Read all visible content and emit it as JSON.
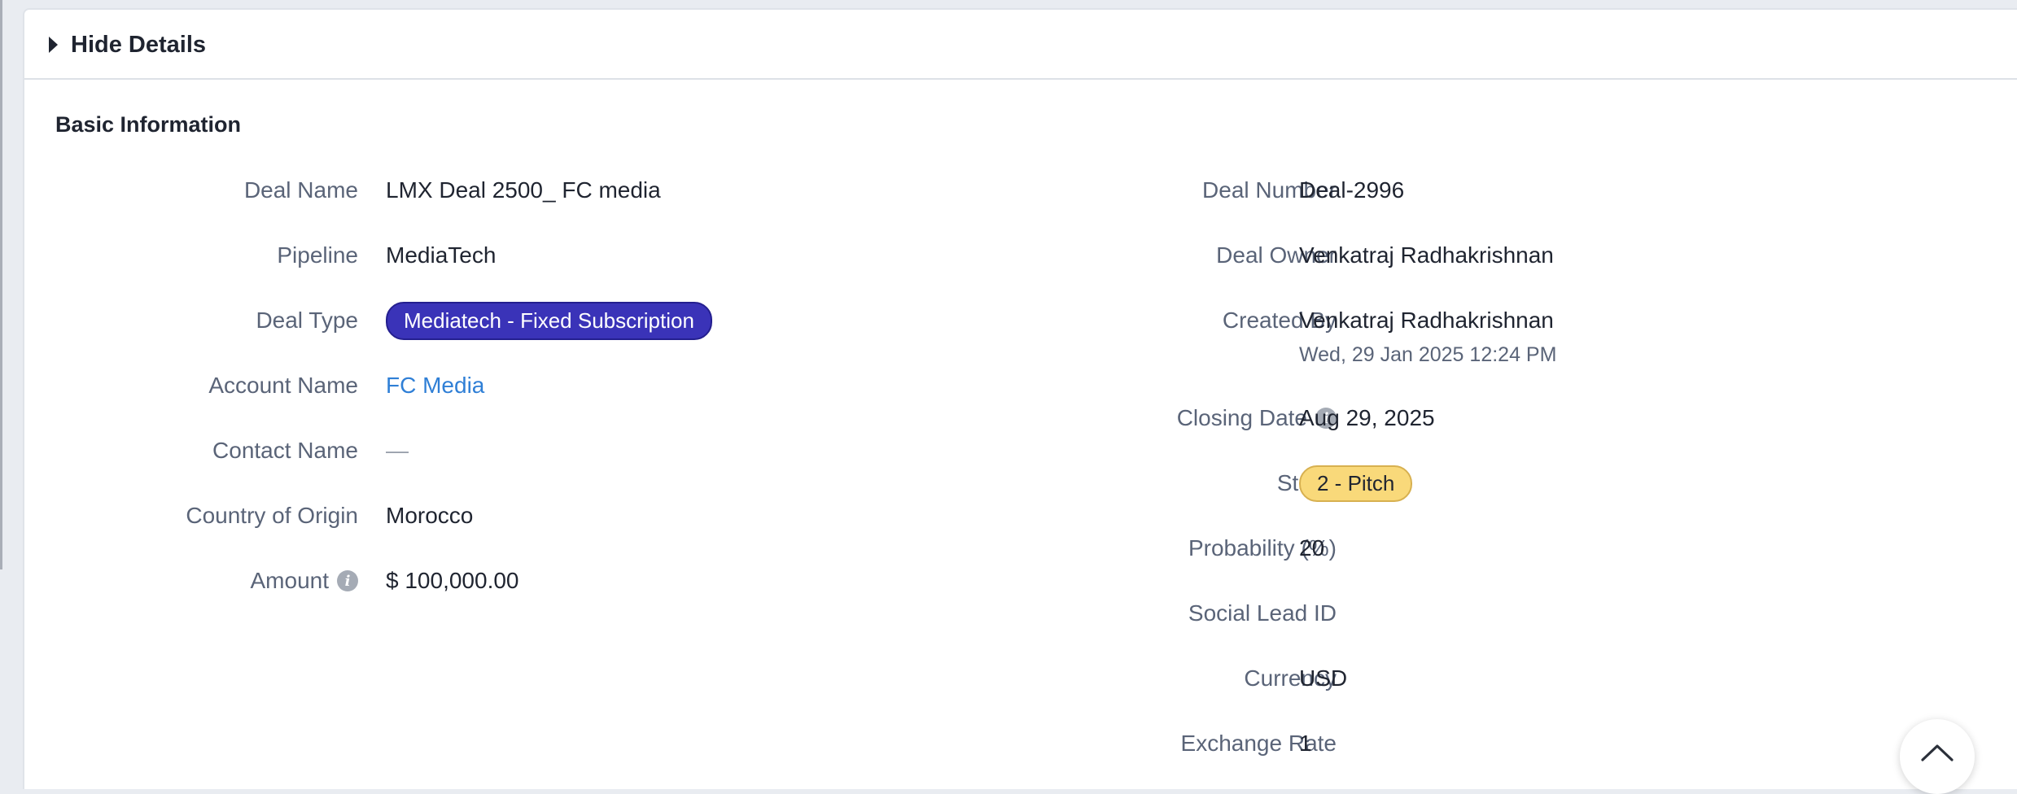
{
  "details_toggle": {
    "label": "Hide Details"
  },
  "section": {
    "title": "Basic Information"
  },
  "left_fields": [
    {
      "label": "Deal Name",
      "value": "LMX Deal 2500_ FC media"
    },
    {
      "label": "Pipeline",
      "value": "MediaTech"
    },
    {
      "label": "Deal Type",
      "value": "Mediatech - Fixed Subscription"
    },
    {
      "label": "Account Name",
      "value": "FC Media"
    },
    {
      "label": "Contact Name",
      "value": "—"
    },
    {
      "label": "Country of Origin",
      "value": "Morocco"
    },
    {
      "label": "Amount",
      "value": "$ 100,000.00"
    }
  ],
  "right_fields": [
    {
      "label": "Deal Number",
      "value": "Deal-2996"
    },
    {
      "label": "Deal Owner",
      "value": "Venkatraj Radhakrishnan"
    },
    {
      "label": "Created By",
      "value": "Venkatraj Radhakrishnan",
      "sub": "Wed, 29 Jan 2025 12:24 PM"
    },
    {
      "label": "Closing Date",
      "value": "Aug 29, 2025"
    },
    {
      "label": "Stage",
      "value": "2 - Pitch"
    },
    {
      "label": "Probability (%)",
      "value": "20"
    },
    {
      "label": "Social Lead ID",
      "value": ""
    },
    {
      "label": "Currency",
      "value": "USD"
    },
    {
      "label": "Exchange Rate",
      "value": "1"
    }
  ],
  "icons": {
    "info": "info-icon",
    "caret": "caret-right-icon",
    "scroll_top": "chevron-up-icon"
  },
  "colors": {
    "deal_type_pill": "#3a33b8",
    "stage_pill": "#f9d97a",
    "link": "#2f7fd6"
  }
}
